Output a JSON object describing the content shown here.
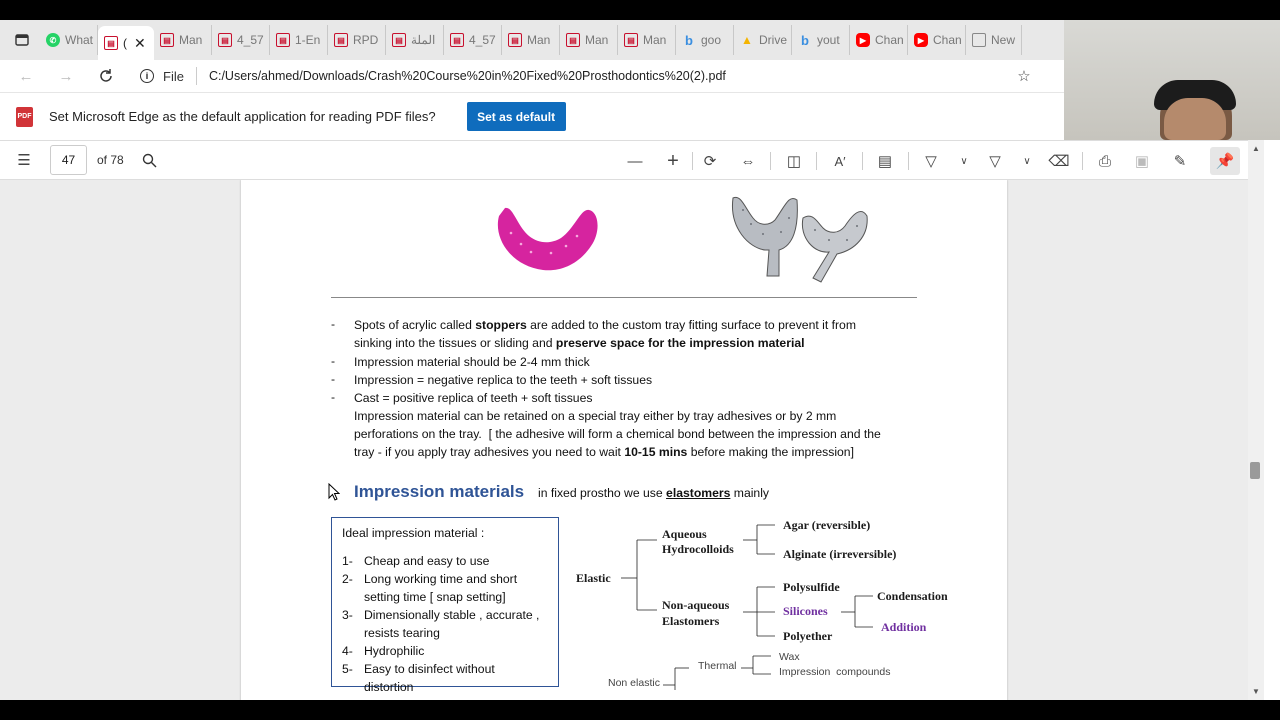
{
  "tabs": [
    {
      "label": "What",
      "icon": "whatsapp-icon",
      "color": "#25d366"
    },
    {
      "label": "(",
      "icon": "pdf-icon",
      "color": "#c8102e",
      "active": true
    },
    {
      "label": "Man",
      "icon": "pdf-icon",
      "color": "#c8102e"
    },
    {
      "label": "4_57",
      "icon": "pdf-icon",
      "color": "#c8102e"
    },
    {
      "label": "1-En",
      "icon": "pdf-icon",
      "color": "#c8102e"
    },
    {
      "label": "RPD",
      "icon": "pdf-icon",
      "color": "#c8102e"
    },
    {
      "label": "الملة",
      "icon": "pdf-icon",
      "color": "#c8102e"
    },
    {
      "label": "4_57",
      "icon": "pdf-icon",
      "color": "#c8102e"
    },
    {
      "label": "Man",
      "icon": "pdf-icon",
      "color": "#c8102e"
    },
    {
      "label": "Man",
      "icon": "pdf-icon",
      "color": "#c8102e"
    },
    {
      "label": "Man",
      "icon": "pdf-icon",
      "color": "#c8102e"
    },
    {
      "label": "goo",
      "icon": "bing-icon",
      "color": "#3b8fe0"
    },
    {
      "label": "Drive",
      "icon": "drive-icon",
      "color": "#f4b400"
    },
    {
      "label": "yout",
      "icon": "bing-icon",
      "color": "#3b8fe0"
    },
    {
      "label": "Chan",
      "icon": "youtube-icon",
      "color": "#ff0000"
    },
    {
      "label": "Chan",
      "icon": "youtube-icon",
      "color": "#ff0000"
    },
    {
      "label": "New",
      "icon": "newtab-icon",
      "color": "#888"
    }
  ],
  "address": {
    "scheme_label": "File",
    "url": "C:/Users/ahmed/Downloads/Crash%20Course%20in%20Fixed%20Prosthodontics%20(2).pdf"
  },
  "banner": {
    "message": "Set Microsoft Edge as the default application for reading PDF files?",
    "button": "Set as default",
    "accent": "#0f6cbd"
  },
  "pdf_toolbar": {
    "page_number": "47",
    "page_total": "of 78"
  },
  "doc": {
    "bullets": [
      {
        "dash": "-",
        "parts": [
          {
            "t": "Spots of acrylic called "
          },
          {
            "t": "stoppers",
            "b": true
          },
          {
            "t": " are added to the custom tray fitting surface to prevent it from"
          }
        ]
      },
      {
        "dash": "",
        "parts": [
          {
            "t": "sinking into the tissues or sliding and "
          },
          {
            "t": "preserve space for the impression material",
            "b": true
          }
        ]
      },
      {
        "dash": "-",
        "parts": [
          {
            "t": "Impression material should be 2-4 mm thick"
          }
        ]
      },
      {
        "dash": "-",
        "parts": [
          {
            "t": "Impression = negative replica to the teeth + soft tissues"
          }
        ]
      },
      {
        "dash": "-",
        "parts": [
          {
            "t": "Cast = positive replica of teeth + soft tissues"
          }
        ]
      },
      {
        "dash": "",
        "parts": [
          {
            "t": "Impression material can be retained on a special tray either by tray adhesives or by 2 mm"
          }
        ]
      },
      {
        "dash": "",
        "parts": [
          {
            "t": "perforations on the tray.  [ the adhesive will form a chemical bond between the impression and the"
          }
        ]
      },
      {
        "dash": "",
        "parts": [
          {
            "t": "tray - if you apply tray adhesives you need to wait "
          },
          {
            "t": "10-15 mins",
            "b": true
          },
          {
            "t": " before making the impression]"
          }
        ]
      }
    ],
    "heading": "Impression materials",
    "heading_note_prefix": "in fixed prostho we use ",
    "heading_note_key": "elastomers",
    "heading_note_suffix": " mainly",
    "heading_color": "#2f5496",
    "ideal_box": {
      "title": "Ideal impression material :",
      "items": [
        {
          "n": "1-",
          "lines": [
            "Cheap and easy to use"
          ]
        },
        {
          "n": "2-",
          "lines": [
            "Long working time and short",
            "setting time [ snap setting]"
          ]
        },
        {
          "n": "3-",
          "lines": [
            "Dimensionally stable , accurate ,",
            "resists tearing"
          ]
        },
        {
          "n": "4-",
          "lines": [
            "Hydrophilic"
          ]
        },
        {
          "n": "5-",
          "lines": [
            "Easy to disinfect without",
            "distortion"
          ]
        }
      ]
    },
    "tree": {
      "elastic": "Elastic",
      "aqueous": [
        "Aqueous",
        "Hydrocolloids"
      ],
      "agar": "Agar (reversible)",
      "alginate": "Alginate (irreversible)",
      "nonaqueous": [
        "Non-aqueous",
        "Elastomers"
      ],
      "polysulfide": "Polysulfide",
      "silicones": "Silicones",
      "condensation": "Condensation",
      "addition": "Addition",
      "polyether": "Polyether",
      "nonelastic": "Non elastic",
      "thermal": "Thermal",
      "wax": "Wax",
      "compounds": "Impression  compounds",
      "purple": "#7030a0"
    }
  }
}
